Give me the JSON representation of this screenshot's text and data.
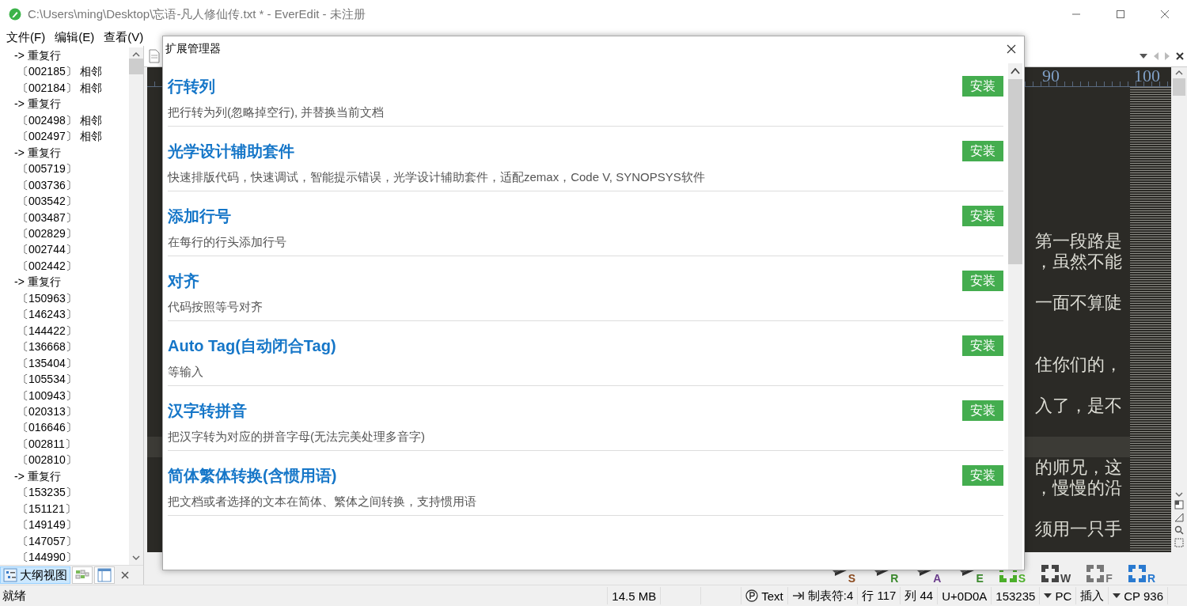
{
  "window": {
    "title": "C:\\Users\\ming\\Desktop\\忘语-凡人修仙传.txt * - EverEdit - 未注册"
  },
  "menu": [
    "文件(F)",
    "编辑(E)",
    "查看(V)"
  ],
  "outline": {
    "groups": [
      {
        "text": "-> 重复行",
        "children": [
          {
            "text": "〔002185〕 相邻"
          },
          {
            "text": "〔002184〕 相邻"
          }
        ]
      },
      {
        "text": "-> 重复行",
        "children": [
          {
            "text": "〔002498〕 相邻"
          },
          {
            "text": "〔002497〕 相邻"
          }
        ]
      },
      {
        "text": "-> 重复行",
        "children": [
          {
            "text": "〔005719〕"
          },
          {
            "text": "〔003736〕"
          },
          {
            "text": "〔003542〕"
          },
          {
            "text": "〔003487〕"
          },
          {
            "text": "〔002829〕"
          },
          {
            "text": "〔002744〕"
          },
          {
            "text": "〔002442〕"
          }
        ]
      },
      {
        "text": "-> 重复行",
        "children": [
          {
            "text": "〔150963〕"
          },
          {
            "text": "〔146243〕"
          },
          {
            "text": "〔144422〕"
          },
          {
            "text": "〔136668〕"
          },
          {
            "text": "〔135404〕"
          },
          {
            "text": "〔105534〕"
          },
          {
            "text": "〔100943〕"
          },
          {
            "text": "〔020313〕"
          },
          {
            "text": "〔016646〕"
          },
          {
            "text": "〔002811〕"
          },
          {
            "text": "〔002810〕"
          }
        ]
      },
      {
        "text": "-> 重复行",
        "children": [
          {
            "text": "〔153235〕"
          },
          {
            "text": "〔151121〕"
          },
          {
            "text": "〔149149〕"
          },
          {
            "text": "〔147057〕"
          },
          {
            "text": "〔144990〕"
          }
        ]
      }
    ],
    "tabs": [
      {
        "label": "大纲视图",
        "selected": true
      },
      {
        "selected": false
      },
      {
        "selected": false
      }
    ]
  },
  "editor": {
    "ruler": [
      "90",
      "100"
    ],
    "paragraphs": [
      [
        "第一段路是",
        "，虽然不能"
      ],
      [
        "一面不算陡"
      ],
      [
        "住你们的，"
      ],
      [
        "入了，是不"
      ],
      [
        "的师兄，这",
        "，慢慢的沿"
      ],
      [
        "须用一只手"
      ]
    ],
    "toolbar": [
      {
        "kind": "tool",
        "letter": "S",
        "color": "#8b4a1e"
      },
      {
        "kind": "tool",
        "letter": "R",
        "color": "#3c8a2e"
      },
      {
        "kind": "tool",
        "letter": "A",
        "color": "#6b3d8c"
      },
      {
        "kind": "tool",
        "letter": "E",
        "color": "#3c8a2e"
      },
      {
        "kind": "frame",
        "letter": "S",
        "color": "#4caf2a"
      },
      {
        "kind": "frame",
        "letter": "W",
        "color": "#444444"
      },
      {
        "kind": "frame",
        "letter": "F",
        "color": "#777777"
      },
      {
        "kind": "frame",
        "letter": "R",
        "color": "#2a7ad0"
      }
    ]
  },
  "dialog": {
    "title": "扩展管理器",
    "extensions": [
      {
        "name": "行转列",
        "description": "把行转为列(忽略掉空行), 并替换当前文档",
        "button": "安装"
      },
      {
        "name": "光学设计辅助套件",
        "description": "快速排版代码，快速调试，智能提示错误，光学设计辅助套件，适配zemax，Code V, SYNOPSYS软件",
        "button": "安装"
      },
      {
        "name": "添加行号",
        "description": "在每行的行头添加行号",
        "button": "安装"
      },
      {
        "name": "对齐",
        "description": "代码按照等号对齐",
        "button": "安装"
      },
      {
        "name": "Auto Tag(自动闭合Tag)",
        "description": "等输入",
        "button": "安装"
      },
      {
        "name": "汉字转拼音",
        "description": "把汉字转为对应的拼音字母(无法完美处理多音字)",
        "button": "安装"
      },
      {
        "name": "简体繁体转换(含惯用语)",
        "description": "把文档或者选择的文本在简体、繁体之间转换，支持惯用语",
        "button": "安装"
      }
    ]
  },
  "status_bar": {
    "message": "就绪",
    "fields": [
      {
        "kind": "plain",
        "text": "14.5 MB"
      },
      {
        "kind": "empty"
      },
      {
        "kind": "empty"
      },
      {
        "kind": "encoding",
        "text": "Text"
      },
      {
        "kind": "tab",
        "text": "制表符:4"
      },
      {
        "kind": "plain",
        "text": "行 117"
      },
      {
        "kind": "plain",
        "text": "列 44"
      },
      {
        "kind": "plain",
        "text": "U+0D0A"
      },
      {
        "kind": "plain",
        "text": "153235"
      },
      {
        "kind": "dropdown",
        "text": "PC"
      },
      {
        "kind": "plain",
        "text": "插入"
      },
      {
        "kind": "dropdown",
        "text": "CP 936"
      }
    ]
  }
}
